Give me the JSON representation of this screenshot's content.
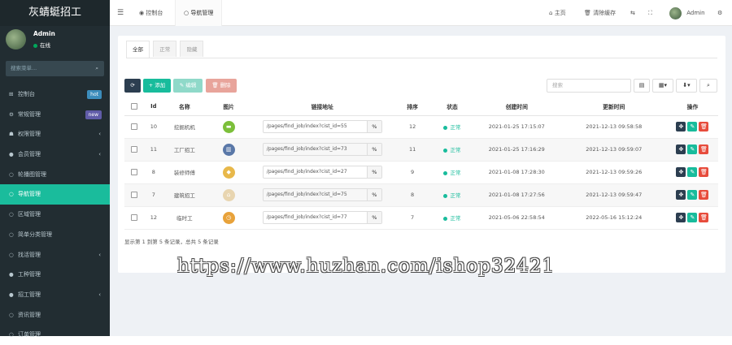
{
  "app": {
    "brand": "灰蜻蜓招工"
  },
  "user": {
    "name": "Admin",
    "status": "在线"
  },
  "sidebar": {
    "search_placeholder": "搜索菜单...",
    "items": [
      {
        "icon": "dashboard-icon",
        "glyph": "⊞",
        "label": "控制台",
        "badge": "hot",
        "badge_color": "#3c8dbc"
      },
      {
        "icon": "cogs-icon",
        "glyph": "⚙",
        "label": "常规管理",
        "badge": "new",
        "badge_color": "#605ca8"
      },
      {
        "icon": "group-icon",
        "glyph": "☗",
        "label": "权限管理",
        "arrow": "‹"
      },
      {
        "icon": "user-circle-icon",
        "glyph": "●",
        "label": "会员管理",
        "arrow": "‹"
      },
      {
        "icon": "circle-icon",
        "glyph": "○",
        "label": "轮播图管理"
      },
      {
        "icon": "circle-icon",
        "glyph": "○",
        "label": "导航管理",
        "active": true
      },
      {
        "icon": "circle-icon",
        "glyph": "○",
        "label": "区域管理"
      },
      {
        "icon": "circle-icon",
        "glyph": "○",
        "label": "简单分类管理"
      },
      {
        "icon": "circle-icon",
        "glyph": "○",
        "label": "找活管理",
        "arrow": "‹"
      },
      {
        "icon": "info-icon",
        "glyph": "●",
        "label": "工种管理"
      },
      {
        "icon": "circle-icon",
        "glyph": "●",
        "label": "招工管理",
        "arrow": "‹"
      },
      {
        "icon": "circle-icon",
        "glyph": "○",
        "label": "资讯管理"
      },
      {
        "icon": "circle-icon",
        "glyph": "○",
        "label": "订单管理"
      }
    ]
  },
  "topbar": {
    "menu_icon": "☰",
    "tabs": [
      {
        "icon": "dashboard-icon",
        "glyph": "◉",
        "label": "控制台"
      },
      {
        "icon": "circle-icon",
        "glyph": "○",
        "label": "导航管理"
      }
    ],
    "home_label": "主页",
    "clear_cache_label": "清除缓存",
    "user_name": "Admin"
  },
  "tabs": [
    "全部",
    "正常",
    "隐藏"
  ],
  "toolbar": {
    "refresh_icon": "⟳",
    "add_label": "+ 添加",
    "edit_label": "✎ 编辑",
    "delete_label": "🗑 删除",
    "search_placeholder": "搜索",
    "colors": {
      "refresh": "#2c3e50",
      "add": "#18bc9c",
      "edit": "#8fd9c9",
      "delete": "#e8a49b"
    }
  },
  "table": {
    "headers": [
      "",
      "Id",
      "名称",
      "图片",
      "链接地址",
      "排序",
      "状态",
      "创建时间",
      "更新时间",
      "操作"
    ],
    "rows": [
      {
        "id": "10",
        "name": "挖掘机机",
        "pic_color": "#7cbf3a",
        "pic_glyph": "▬",
        "link": "/pages/find_job/index?cist_id=55",
        "sort": "12",
        "status": "正常",
        "created": "2021-01-25 17:15:07",
        "updated": "2021-12-13 09:58:58"
      },
      {
        "id": "11",
        "name": "工厂招工",
        "pic_color": "#5a78a8",
        "pic_glyph": "▥",
        "link": "/pages/find_job/index?cist_id=73",
        "sort": "11",
        "status": "正常",
        "created": "2021-01-25 17:16:29",
        "updated": "2021-12-13 09:59:07"
      },
      {
        "id": "8",
        "name": "装修师傅",
        "pic_color": "#e8b84a",
        "pic_glyph": "◆",
        "link": "/pages/find_job/index?cist_id=27",
        "sort": "9",
        "status": "正常",
        "created": "2021-01-08 17:28:30",
        "updated": "2021-12-13 09:59:26"
      },
      {
        "id": "7",
        "name": "建筑招工",
        "pic_color": "#e8d5b0",
        "pic_glyph": "⌂",
        "link": "/pages/find_job/index?cist_id=75",
        "sort": "8",
        "status": "正常",
        "created": "2021-01-08 17:27:56",
        "updated": "2021-12-13 09:59:47"
      },
      {
        "id": "12",
        "name": "临时工",
        "pic_color": "#e8a23a",
        "pic_glyph": "◷",
        "link": "/pages/find_job/index?cist_id=77",
        "sort": "7",
        "status": "正常",
        "created": "2021-05-06 22:58:54",
        "updated": "2022-05-16 15:12:24"
      }
    ],
    "op_colors": {
      "drag": "#2c3e50",
      "edit": "#18bc9c",
      "delete": "#e74c3c"
    }
  },
  "footer_info": "显示第 1 到第 5 条记录，总共 5 条记录",
  "watermark": "https://www.huzhan.com/ishop32421"
}
